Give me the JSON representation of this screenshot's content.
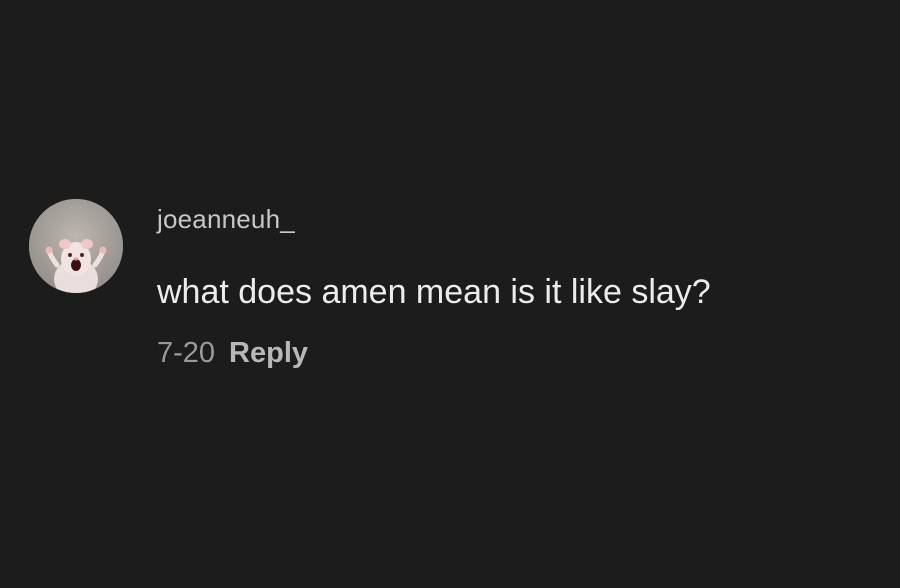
{
  "comment": {
    "avatar_icon": "rat-meme-avatar-icon",
    "username": "joeanneuh_",
    "text": "what does amen mean is it like slay?",
    "timestamp": "7-20",
    "reply_label": "Reply"
  },
  "colors": {
    "background": "#1c1c1c",
    "username": "#c7c7c7",
    "comment_text": "#ececec",
    "timestamp": "#9a9a9a",
    "reply": "#b8b8b8"
  }
}
